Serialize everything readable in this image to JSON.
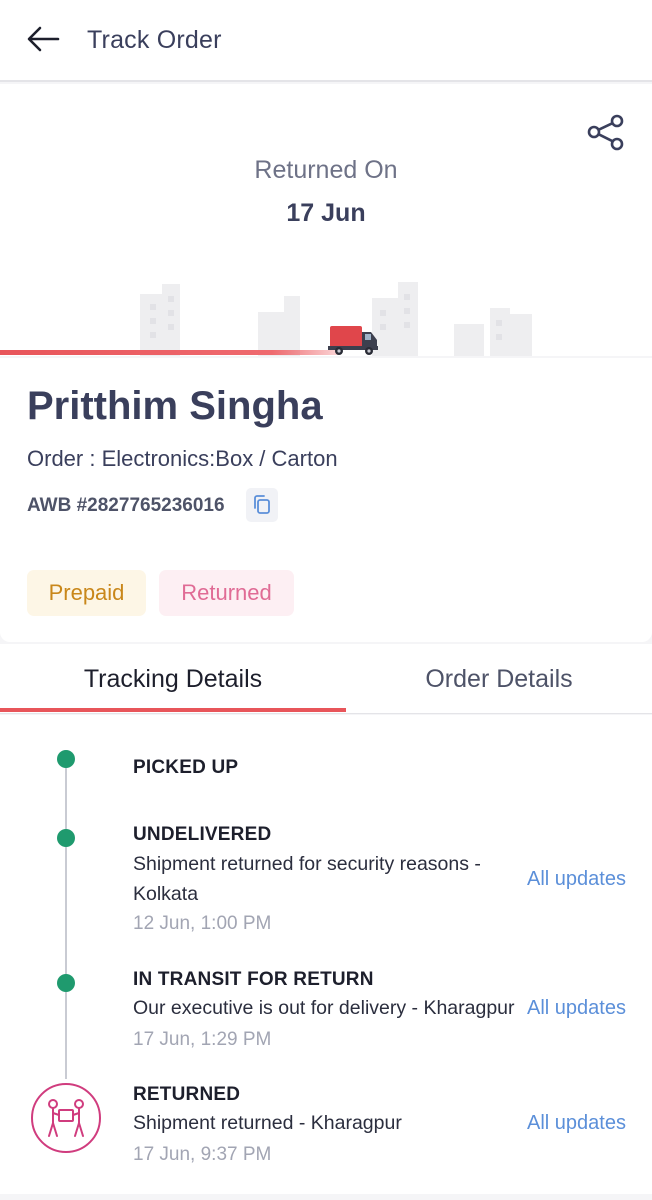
{
  "header": {
    "title": "Track Order"
  },
  "hero": {
    "status_label": "Returned On",
    "status_date": "17 Jun"
  },
  "shipment": {
    "customer_name": "Pritthim Singha",
    "order_text": "Order : Electronics:Box / Carton",
    "awb_text": "AWB #2827765236016",
    "badges": {
      "payment": "Prepaid",
      "status": "Returned"
    }
  },
  "tabs": {
    "tracking": "Tracking Details",
    "order": "Order Details"
  },
  "timeline": {
    "steps": [
      {
        "title": "PICKED UP"
      },
      {
        "title": "UNDELIVERED",
        "description": "Shipment returned for security reasons - Kolkata",
        "time": "12 Jun, 1:00 PM",
        "link": "All updates"
      },
      {
        "title": "IN TRANSIT FOR RETURN",
        "description": "Our executive is out for delivery - Kharagpur",
        "time": "17 Jun, 1:29 PM",
        "link": "All updates"
      },
      {
        "title": "RETURNED",
        "description": "Shipment returned - Kharagpur",
        "time": "17 Jun, 9:37 PM",
        "link": "All updates"
      }
    ]
  },
  "colors": {
    "accent": "#e8555a",
    "done_dot": "#1f9a6e",
    "link": "#5b8fd9",
    "returned_icon": "#d03c7e"
  }
}
